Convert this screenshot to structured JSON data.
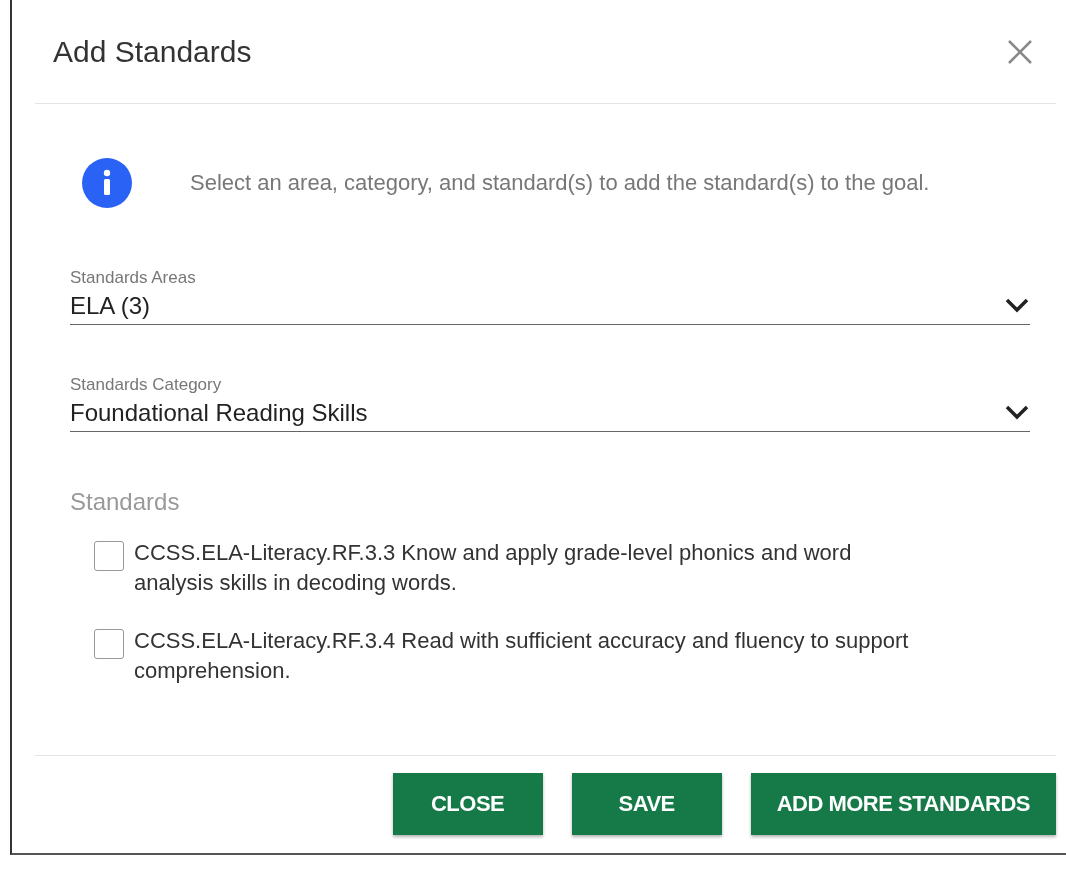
{
  "dialog": {
    "title": "Add Standards"
  },
  "info": {
    "text": "Select an area, category, and standard(s) to add the standard(s) to the goal."
  },
  "fields": [
    {
      "label": "Standards Areas",
      "value": "ELA (3)"
    },
    {
      "label": "Standards Category",
      "value": "Foundational Reading Skills"
    }
  ],
  "standards": {
    "heading": "Standards",
    "items": [
      {
        "text": "CCSS.ELA-Literacy.RF.3.3 Know and apply grade-level phonics and word analysis skills in decoding words.",
        "checked": false
      },
      {
        "text": "CCSS.ELA-Literacy.RF.3.4 Read with sufficient accuracy and fluency to support comprehension.",
        "checked": false
      }
    ]
  },
  "buttons": [
    "CLOSE",
    "SAVE",
    "ADD MORE STANDARDS"
  ]
}
